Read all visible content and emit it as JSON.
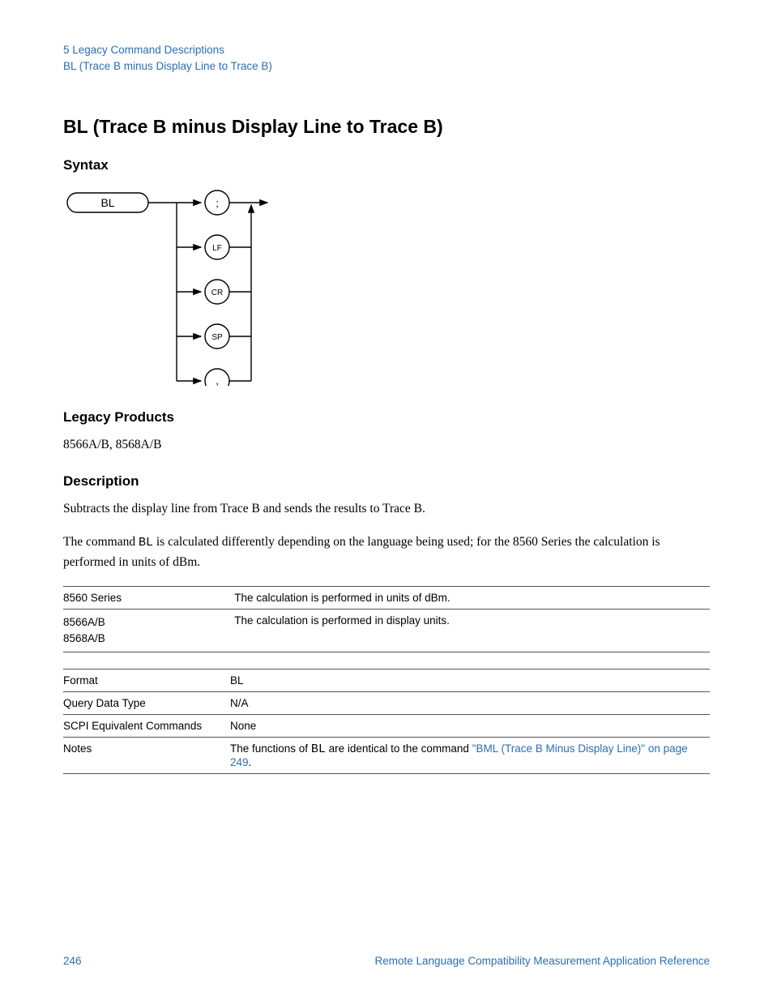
{
  "breadcrumb": {
    "line1": "5  Legacy Command Descriptions",
    "line2": "BL (Trace B minus Display Line to Trace B)"
  },
  "title": "BL (Trace B minus Display Line to Trace B)",
  "sections": {
    "syntax": "Syntax",
    "legacy_products": "Legacy Products",
    "description": "Description"
  },
  "syntax_diagram": {
    "start": "BL",
    "terminators": [
      ";",
      "LF",
      "CR",
      "SP",
      ","
    ]
  },
  "legacy_products_text": "8566A/B, 8568A/B",
  "description_p1": "Subtracts the display line from Trace B and sends the results to Trace B.",
  "description_p2_prefix": "The command ",
  "description_p2_code": "BL",
  "description_p2_suffix": " is calculated differently depending on the language being used; for the 8560 Series the calculation is performed in units of dBm.",
  "calc_table": [
    {
      "key": "8560 Series",
      "val": "The calculation is performed in units of dBm."
    },
    {
      "key": "8566A/B 8568A/B",
      "val": "The calculation is performed in display units."
    }
  ],
  "props_table": {
    "format": {
      "key": "Format",
      "val": "BL"
    },
    "query": {
      "key": "Query Data Type",
      "val": "N/A"
    },
    "scpi": {
      "key": "SCPI Equivalent Commands",
      "val": "None"
    },
    "notes": {
      "key": "Notes",
      "prefix": "The functions of ",
      "code": "BL",
      "mid": " are identical to the command ",
      "link": "\"BML (Trace B Minus Display Line)\" on page 249",
      "suffix": "."
    }
  },
  "footer": {
    "page": "246",
    "doc": "Remote Language Compatibility Measurement Application Reference"
  }
}
